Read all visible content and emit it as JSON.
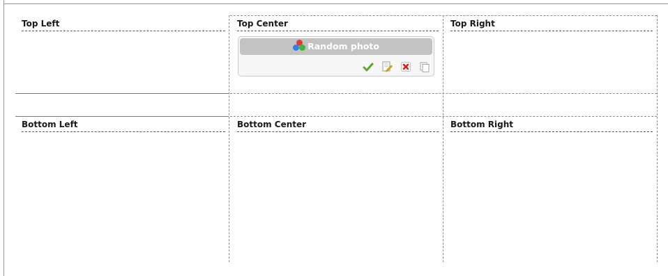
{
  "zones": {
    "top_left": "Top Left",
    "top_center": "Top Center",
    "top_right": "Top Right",
    "bottom_left": "Bottom Left",
    "bottom_center": "Bottom Center",
    "bottom_right": "Bottom Right"
  },
  "widget": {
    "title": "Random photo",
    "icon": "colored-balls-icon",
    "tools": [
      "check-icon",
      "edit-icon",
      "delete-icon",
      "copy-icon"
    ]
  }
}
